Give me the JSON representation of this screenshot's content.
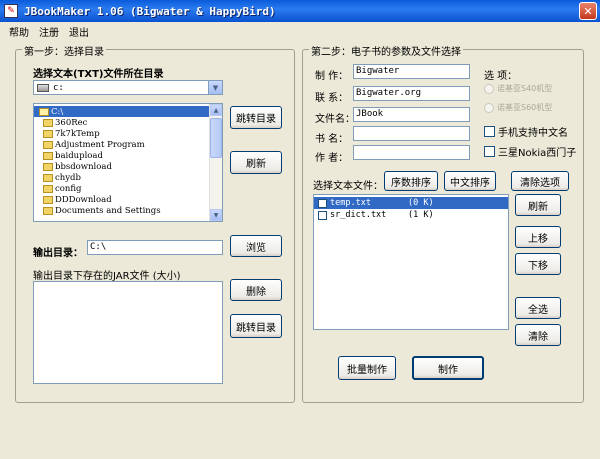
{
  "window": {
    "title": "JBookMaker 1.06 (Bigwater & HappyBird)",
    "close_glyph": "✕"
  },
  "menu": [
    "帮助",
    "注册",
    "退出"
  ],
  "step1": {
    "title": "第一步：选择目录",
    "source_label": "选择文本(TXT)文件所在目录",
    "drive": "c:",
    "dirs": [
      {
        "name": "C:\\",
        "selected": true,
        "open": true
      },
      {
        "name": "360Rec"
      },
      {
        "name": "7k7kTemp"
      },
      {
        "name": "Adjustment Program"
      },
      {
        "name": "baidupload"
      },
      {
        "name": "bbsdownload"
      },
      {
        "name": "chydb"
      },
      {
        "name": "config"
      },
      {
        "name": "DDDownload"
      },
      {
        "name": "Documents and Settings"
      }
    ],
    "goto_dir_button": "跳转目录",
    "refresh_button": "刷新",
    "output_label": "输出目录：",
    "output_value": "C:\\",
    "browse_button": "浏览",
    "jar_list_label": "输出目录下存在的JAR文件 (大小)",
    "delete_button": "删除",
    "goto_dir_button_2": "跳转目录"
  },
  "step2": {
    "title": "第二步：电子书的参数及文件选择",
    "fields": [
      {
        "label": "制  作：",
        "value": "Bigwater"
      },
      {
        "label": "联  系：",
        "value": "Bigwater.org"
      },
      {
        "label": "文件名：",
        "value": "JBook"
      },
      {
        "label": "书  名：",
        "value": ""
      },
      {
        "label": "作  者：",
        "value": ""
      }
    ],
    "options_label": "选  项：",
    "radio_options": [
      "诺基亚S40机型",
      "诺基亚S60机型"
    ],
    "checkbox_options": [
      "手机支持中文名",
      "三星Nokia西门子"
    ],
    "select_files_label": "选择文本文件：",
    "sort_number_button": "序数排序",
    "sort_chinese_button": "中文排序",
    "clear_selection_button": "清除选项",
    "files": [
      {
        "name": "temp.txt",
        "size": "(0 K)",
        "selected": true
      },
      {
        "name": "sr_dict.txt",
        "size": "(1 K)",
        "selected": false
      }
    ],
    "refresh_button": "刷新",
    "move_up_button": "上移",
    "move_down_button": "下移",
    "select_all_button": "全选",
    "clear_button": "清除",
    "batch_make_button": "批量制作",
    "make_button": "制作"
  }
}
